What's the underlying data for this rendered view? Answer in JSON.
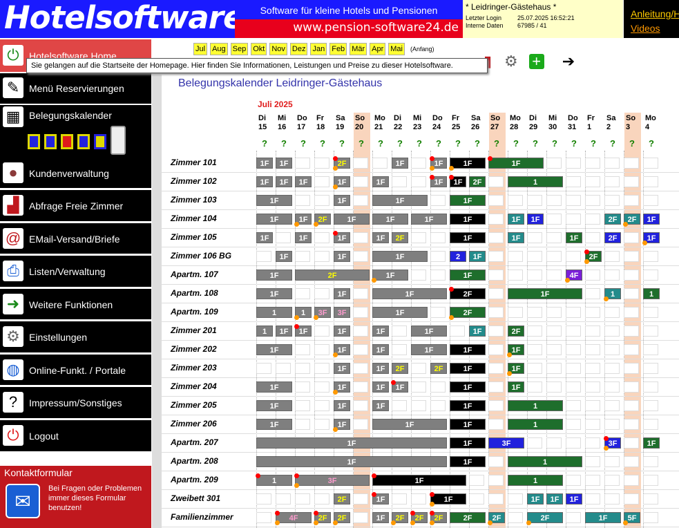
{
  "header": {
    "logo": "Hotelsoftware",
    "tagline": "Software für kleine Hotels und Pensionen",
    "url": "www.pension-software24.de",
    "info_title": "* Leidringer-Gästehaus *",
    "last_login_label": "Letzter Login",
    "last_login": "25.07.2025 16:52:21",
    "internal_label": "Interne Daten",
    "internal": "67985 / 41",
    "help_link": "Anleitung/Hilfe",
    "videos_link": "Videos"
  },
  "tooltip": "Sie gelangen auf die Startseite der Homepage. Hier finden Sie Informationen, Leistungen und Preise zu dieser Hotelsoftware.",
  "months": [
    "Jul",
    "Aug",
    "Sep",
    "Okt",
    "Nov",
    "Dez",
    "Jan",
    "Feb",
    "Mär",
    "Apr",
    "Mai"
  ],
  "months_start": "(Anfang)",
  "sidebar": {
    "items": [
      "Hotelsoftware Home",
      "Menü Reservierungen",
      "Belegungskalender",
      "Kundenverwaltung",
      "Abfrage Freie Zimmer",
      "EMail-Versand/Briefe",
      "Listen/Verwaltung",
      "Weitere Funktionen",
      "Einstellungen",
      "Online-Funkt. / Portale",
      "Impressum/Sonstiges",
      "Logout"
    ],
    "contact_title": "Kontaktformular",
    "contact_text": "Bei Fragen oder Problemen immer dieses Formular benutzen!"
  },
  "calendar": {
    "title": "Belegungskalender  Leidringer-Gästehaus",
    "month": "Juli 2025",
    "days": [
      [
        "Di",
        "15"
      ],
      [
        "Mi",
        "16"
      ],
      [
        "Do",
        "17"
      ],
      [
        "Fr",
        "18"
      ],
      [
        "Sa",
        "19"
      ],
      [
        "So",
        "20"
      ],
      [
        "Mo",
        "21"
      ],
      [
        "Di",
        "22"
      ],
      [
        "Mi",
        "23"
      ],
      [
        "Do",
        "24"
      ],
      [
        "Fr",
        "25"
      ],
      [
        "Sa",
        "26"
      ],
      [
        "So",
        "27"
      ],
      [
        "Mo",
        "28"
      ],
      [
        "Di",
        "29"
      ],
      [
        "Mi",
        "30"
      ],
      [
        "Do",
        "31"
      ],
      [
        "Fr",
        "1"
      ],
      [
        "Sa",
        "2"
      ],
      [
        "So",
        "3"
      ],
      [
        "Mo",
        "4"
      ]
    ],
    "q": "?",
    "rooms": [
      "Zimmer 101",
      "Zimmer 102",
      "Zimmer 103",
      "Zimmer 104",
      "Zimmer 105",
      "Zimmer 106 BG",
      "Apartm. 107",
      "Apartm. 108",
      "Apartm. 109",
      "Zimmer 201",
      "Zimmer 202",
      "Zimmer 203",
      "Zimmer 204",
      "Zimmer 205",
      "Zimmer 206",
      "Apartm. 207",
      "Apartm. 208",
      "Apartm. 209",
      "Zweibett 301",
      "Familienzimmer"
    ]
  }
}
